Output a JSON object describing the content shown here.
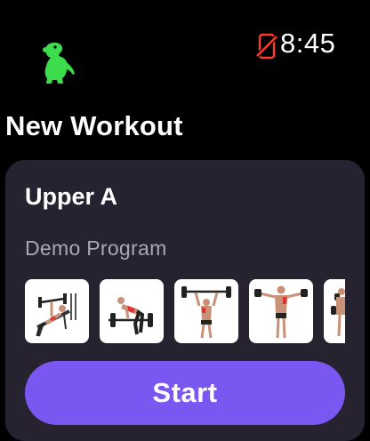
{
  "status": {
    "time": "8:45",
    "connectivity_icon": "phone-disconnected-icon",
    "connectivity_color": "#ff3b30"
  },
  "app": {
    "logo_icon": "dinosaur-logo-icon",
    "logo_color": "#3ddc4c"
  },
  "page": {
    "title": "New Workout"
  },
  "workout_card": {
    "name": "Upper A",
    "program": "Demo Program",
    "exercise_icons": [
      "bench-press-exercise-icon",
      "barbell-row-exercise-icon",
      "overhead-press-exercise-icon",
      "lateral-raise-exercise-icon",
      "dumbbell-exercise-icon"
    ],
    "start_label": "Start",
    "accent_color": "#7b57f2",
    "card_background": "#26222f"
  }
}
